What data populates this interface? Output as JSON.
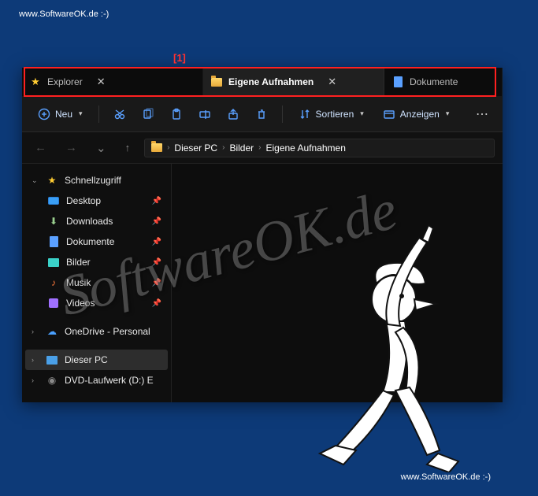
{
  "watermark": "www.SoftwareOK.de  :-)",
  "watermark_big": "SoftwareOK.de",
  "annotation": "[1]",
  "tabs": [
    {
      "label": "Explorer",
      "active": false
    },
    {
      "label": "Eigene Aufnahmen",
      "active": true
    },
    {
      "label": "Dokumente",
      "active": false
    }
  ],
  "toolbar": {
    "new_label": "Neu",
    "sort_label": "Sortieren",
    "view_label": "Anzeigen"
  },
  "breadcrumb": [
    "Dieser PC",
    "Bilder",
    "Eigene Aufnahmen"
  ],
  "sidebar": {
    "quick": "Schnellzugriff",
    "items": [
      {
        "label": "Desktop"
      },
      {
        "label": "Downloads"
      },
      {
        "label": "Dokumente"
      },
      {
        "label": "Bilder"
      },
      {
        "label": "Musik"
      },
      {
        "label": "Videos"
      }
    ],
    "onedrive": "OneDrive - Personal",
    "thispc": "Dieser PC",
    "dvd": "DVD-Laufwerk (D:) E"
  }
}
